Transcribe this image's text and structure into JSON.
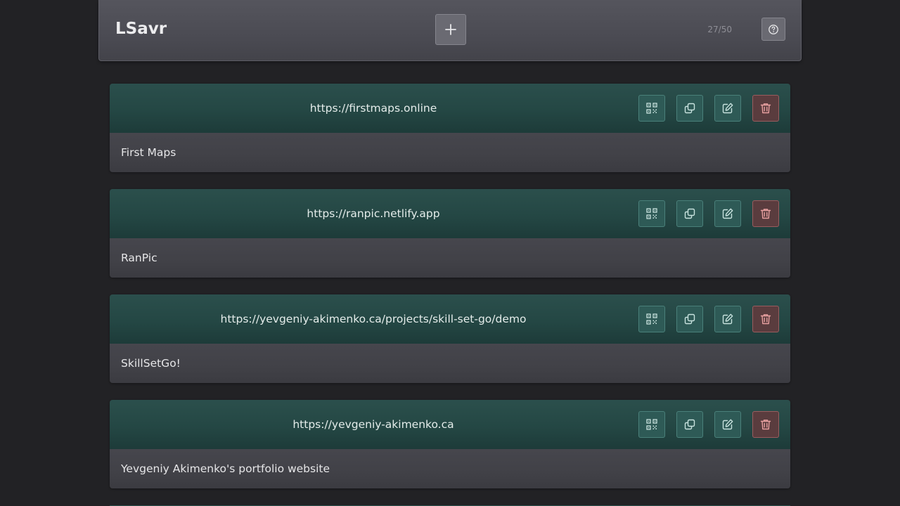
{
  "app": {
    "title": "LSavr",
    "counter": "27/50",
    "add_icon": "plus-icon",
    "help_icon": "question-circle-icon"
  },
  "links": [
    {
      "url": "https://firstmaps.online",
      "title": "First Maps"
    },
    {
      "url": "https://ranpic.netlify.app",
      "title": "RanPic"
    },
    {
      "url": "https://yevgeniy-akimenko.ca/projects/skill-set-go/demo",
      "title": "SkillSetGo!"
    },
    {
      "url": "https://yevgeniy-akimenko.ca",
      "title": "Yevgeniy Akimenko's portfolio website"
    }
  ],
  "actions": [
    {
      "name": "qr-code",
      "icon": "qr-code-icon"
    },
    {
      "name": "copy",
      "icon": "copy-icon"
    },
    {
      "name": "edit",
      "icon": "edit-icon"
    },
    {
      "name": "delete",
      "icon": "trash-icon"
    }
  ],
  "colors": {
    "background": "#222225",
    "header": "#4b4b53",
    "card_top": "#244744",
    "card_bottom": "#414147",
    "action_teal": "#2e5a56",
    "action_delete": "#5a3c3e",
    "delete_icon": "#e8a0a0",
    "teal_icon": "#c8e2de"
  }
}
